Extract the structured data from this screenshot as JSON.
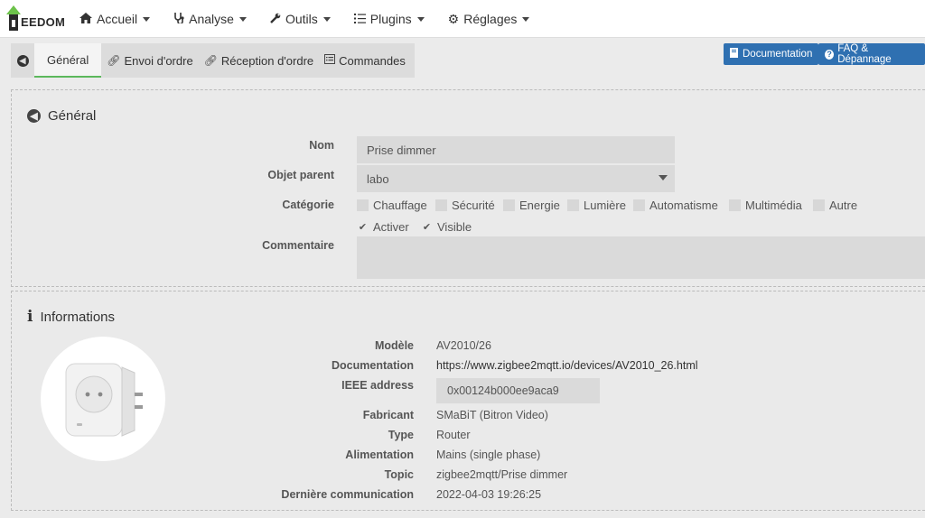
{
  "app": {
    "logo_text": "EEDOM"
  },
  "nav": {
    "items": [
      {
        "label": "Accueil",
        "icon": "home-icon"
      },
      {
        "label": "Analyse",
        "icon": "stethoscope-icon"
      },
      {
        "label": "Outils",
        "icon": "wrench-icon"
      },
      {
        "label": "Plugins",
        "icon": "list-icon"
      },
      {
        "label": "Réglages",
        "icon": "gear-icon"
      }
    ]
  },
  "tabs": {
    "general": "Général",
    "send": "Envoi d'ordre",
    "receive": "Réception d'ordre",
    "commands": "Commandes"
  },
  "buttons": {
    "documentation": "Documentation",
    "faq": "FAQ & Dépannage"
  },
  "general": {
    "title": "Général",
    "name_label": "Nom",
    "name_value": "Prise dimmer",
    "parent_label": "Objet parent",
    "parent_value": "labo",
    "category_label": "Catégorie",
    "categories": [
      "Chauffage",
      "Sécurité",
      "Energie",
      "Lumière",
      "Automatisme",
      "Multimédia",
      "Autre"
    ],
    "activate": "Activer",
    "visible": "Visible",
    "activate_checked": true,
    "visible_checked": true,
    "comment_label": "Commentaire",
    "comment_value": ""
  },
  "info": {
    "title": "Informations",
    "model_label": "Modèle",
    "model_value": "AV2010/26",
    "doc_label": "Documentation",
    "doc_value": "https://www.zigbee2mqtt.io/devices/AV2010_26.html",
    "ieee_label": "IEEE address",
    "ieee_value": "0x00124b000ee9aca9",
    "maker_label": "Fabricant",
    "maker_value": "SMaBiT (Bitron Video)",
    "type_label": "Type",
    "type_value": "Router",
    "power_label": "Alimentation",
    "power_value": "Mains (single phase)",
    "topic_label": "Topic",
    "topic_value": "zigbee2mqtt/Prise dimmer",
    "lastcomm_label": "Dernière communication",
    "lastcomm_value": "2022-04-03 19:26:25"
  },
  "colors": {
    "accent_green": "#5cb85c",
    "button_blue": "#2f70b1",
    "logo_green": "#6cc24a"
  }
}
